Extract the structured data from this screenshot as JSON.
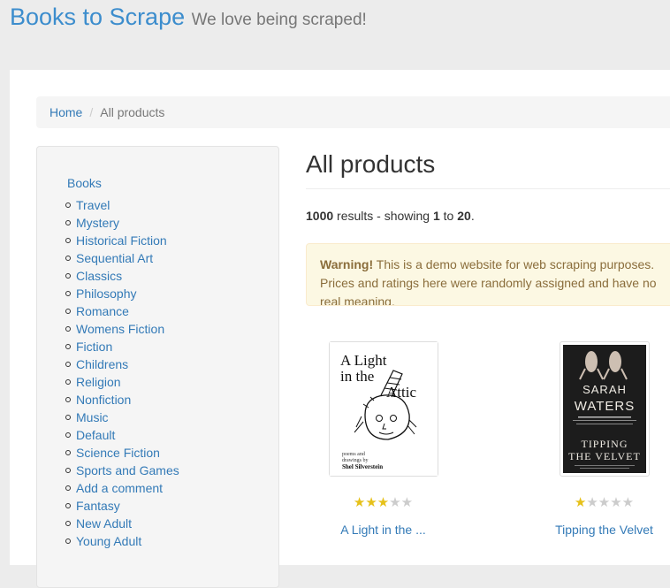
{
  "header": {
    "brand": "Books to Scrape",
    "tagline": "We love being scraped!"
  },
  "breadcrumb": {
    "home": "Home",
    "current": "All products"
  },
  "sidebar": {
    "root": "Books",
    "categories": [
      "Travel",
      "Mystery",
      "Historical Fiction",
      "Sequential Art",
      "Classics",
      "Philosophy",
      "Romance",
      "Womens Fiction",
      "Fiction",
      "Childrens",
      "Religion",
      "Nonfiction",
      "Music",
      "Default",
      "Science Fiction",
      "Sports and Games",
      "Add a comment",
      "Fantasy",
      "New Adult",
      "Young Adult"
    ]
  },
  "main": {
    "heading": "All products",
    "results": {
      "total": "1000",
      "middle": " results - showing ",
      "from": "1",
      "to_word": " to ",
      "to": "20",
      "end": "."
    },
    "alert": {
      "strong": "Warning!",
      "text": " This is a demo website for web scraping purposes. Prices and ratings here were randomly assigned and have no real meaning."
    }
  },
  "products": [
    {
      "title": "A Light in the ...",
      "rating": 3,
      "cover": {
        "line1": "A Light",
        "line2": "in the",
        "line3": "Attic",
        "small1": "poems and",
        "small2": "drawings by",
        "author": "Shel Silverstein"
      }
    },
    {
      "title": "Tipping the Velvet",
      "rating": 1,
      "cover": {
        "author1": "SARAH",
        "author2": "WATERS",
        "t1": "TIPPING",
        "t2": "THE VELVET"
      }
    }
  ],
  "colors": {
    "link": "#337ab7",
    "star_on": "#e6c11a",
    "star_off": "#cccccc",
    "alert_bg": "#fcf8e3"
  }
}
